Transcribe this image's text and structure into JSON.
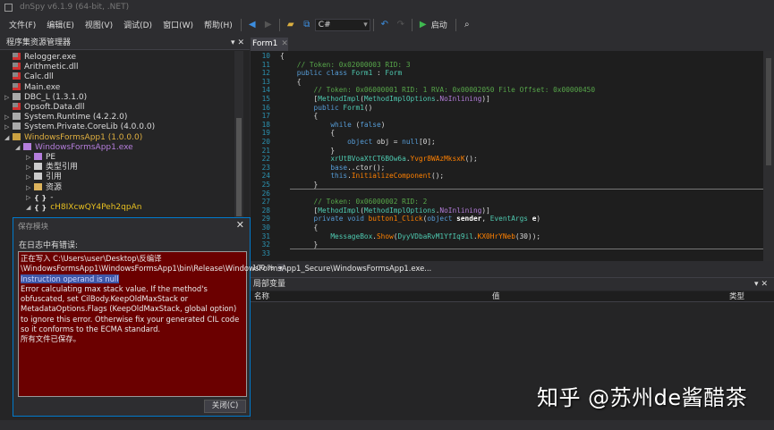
{
  "window": {
    "title": "dnSpy v6.1.9 (64-bit, .NET)"
  },
  "menu": [
    {
      "label": "文件(F)"
    },
    {
      "label": "编辑(E)"
    },
    {
      "label": "视图(V)"
    },
    {
      "label": "调试(D)"
    },
    {
      "label": "窗口(W)"
    },
    {
      "label": "帮助(H)"
    }
  ],
  "toolbar": {
    "language": "C#",
    "start_label": "启动"
  },
  "assembly_explorer": {
    "title": "程序集资源管理器",
    "nodes": [
      {
        "label": "Relogger.exe",
        "depth": 0,
        "expander": "",
        "icon": "assembly-error",
        "color": "#dcdcdc"
      },
      {
        "label": "Arithmetic.dll",
        "depth": 0,
        "expander": "",
        "icon": "assembly-error",
        "color": "#dcdcdc"
      },
      {
        "label": "Calc.dll",
        "depth": 0,
        "expander": "",
        "icon": "assembly-error",
        "color": "#dcdcdc"
      },
      {
        "label": "Main.exe",
        "depth": 0,
        "expander": "",
        "icon": "assembly-error",
        "color": "#dcdcdc"
      },
      {
        "label": "DBC_L (1.3.1.0)",
        "depth": 0,
        "expander": "▷",
        "icon": "assembly",
        "color": "#dcdcdc"
      },
      {
        "label": "Opsoft.Data.dll",
        "depth": 0,
        "expander": "",
        "icon": "assembly-error",
        "color": "#dcdcdc"
      },
      {
        "label": "System.Runtime (4.2.2.0)",
        "depth": 0,
        "expander": "▷",
        "icon": "assembly",
        "color": "#dcdcdc"
      },
      {
        "label": "System.Private.CoreLib (4.0.0.0)",
        "depth": 0,
        "expander": "▷",
        "icon": "assembly",
        "color": "#dcdcdc"
      },
      {
        "label": "WindowsFormsApp1 (1.0.0.0)",
        "depth": 0,
        "expander": "◢",
        "icon": "assembly-open",
        "color": "#e0b040"
      },
      {
        "label": "WindowsFormsApp1.exe",
        "depth": 1,
        "expander": "◢",
        "icon": "module",
        "color": "#b57edc"
      },
      {
        "label": "PE",
        "depth": 2,
        "expander": "▷",
        "icon": "module",
        "color": "#dcdcdc"
      },
      {
        "label": "类型引用",
        "depth": 2,
        "expander": "▷",
        "icon": "references",
        "color": "#dcdcdc"
      },
      {
        "label": "引用",
        "depth": 2,
        "expander": "▷",
        "icon": "references",
        "color": "#dcdcdc"
      },
      {
        "label": "资源",
        "depth": 2,
        "expander": "▷",
        "icon": "folder",
        "color": "#dcdcdc"
      },
      {
        "label": "-",
        "depth": 2,
        "expander": "▷",
        "icon": "namespace",
        "color": "#dcdcdc"
      },
      {
        "label": "cH8IXcwQY4Peh2qpAn",
        "depth": 2,
        "expander": "◢",
        "icon": "namespace",
        "color": "#e8c020"
      }
    ]
  },
  "editor": {
    "tab": "Form1",
    "zoom": "100 %",
    "lines": [
      {
        "n": "10",
        "tokens": [
          {
            "t": "{",
            "c": "pl"
          }
        ]
      },
      {
        "n": "11",
        "tokens": [
          {
            "t": "    // Token: 0x02000003 RID: 3",
            "c": "cm"
          }
        ]
      },
      {
        "n": "12",
        "tokens": [
          {
            "t": "    public class ",
            "c": "kw"
          },
          {
            "t": "Form1",
            "c": "ty"
          },
          {
            "t": " : ",
            "c": "pl"
          },
          {
            "t": "Form",
            "c": "ty"
          }
        ]
      },
      {
        "n": "13",
        "tokens": [
          {
            "t": "    {",
            "c": "pl"
          }
        ]
      },
      {
        "n": "14",
        "tokens": [
          {
            "t": "        // Token: 0x06000001 RID: 1 RVA: 0x00002050 File Offset: 0x00000450",
            "c": "cm"
          }
        ]
      },
      {
        "n": "15",
        "tokens": [
          {
            "t": "        [",
            "c": "pl"
          },
          {
            "t": "MethodImpl",
            "c": "ty"
          },
          {
            "t": "(",
            "c": "pl"
          },
          {
            "t": "MethodImplOptions",
            "c": "ty"
          },
          {
            "t": ".",
            "c": "pl"
          },
          {
            "t": "NoInlining",
            "c": "en"
          },
          {
            "t": ")]",
            "c": "pl"
          }
        ]
      },
      {
        "n": "16",
        "tokens": [
          {
            "t": "        public ",
            "c": "kw"
          },
          {
            "t": "Form1",
            "c": "ty"
          },
          {
            "t": "()",
            "c": "pl"
          }
        ]
      },
      {
        "n": "17",
        "tokens": [
          {
            "t": "        {",
            "c": "pl"
          }
        ]
      },
      {
        "n": "18",
        "tokens": [
          {
            "t": "            while ",
            "c": "kw"
          },
          {
            "t": "(",
            "c": "pl"
          },
          {
            "t": "false",
            "c": "kw"
          },
          {
            "t": ")",
            "c": "pl"
          }
        ]
      },
      {
        "n": "19",
        "tokens": [
          {
            "t": "            {",
            "c": "pl"
          }
        ]
      },
      {
        "n": "20",
        "tokens": [
          {
            "t": "                object ",
            "c": "kw"
          },
          {
            "t": "obj",
            "c": "pl"
          },
          {
            "t": " = ",
            "c": "pl"
          },
          {
            "t": "null",
            "c": "kw"
          },
          {
            "t": "[0];",
            "c": "pl"
          }
        ]
      },
      {
        "n": "21",
        "tokens": [
          {
            "t": "            }",
            "c": "pl"
          }
        ]
      },
      {
        "n": "22",
        "tokens": [
          {
            "t": "            xrUtBVoaXtCT6BOw6a",
            "c": "ty"
          },
          {
            "t": ".",
            "c": "pl"
          },
          {
            "t": "Yvgr8WAzMksxK",
            "c": "me"
          },
          {
            "t": "();",
            "c": "pl"
          }
        ]
      },
      {
        "n": "23",
        "tokens": [
          {
            "t": "            base",
            "c": "kw"
          },
          {
            "t": "..ctor();",
            "c": "pl"
          }
        ]
      },
      {
        "n": "24",
        "tokens": [
          {
            "t": "            this",
            "c": "kw"
          },
          {
            "t": ".",
            "c": "pl"
          },
          {
            "t": "InitializeComponent",
            "c": "me"
          },
          {
            "t": "();",
            "c": "pl"
          }
        ]
      },
      {
        "n": "25",
        "tokens": [
          {
            "t": "        }",
            "c": "pl"
          }
        ],
        "sep": true
      },
      {
        "n": "26",
        "tokens": []
      },
      {
        "n": "27",
        "tokens": [
          {
            "t": "        // Token: 0x06000002 RID: 2",
            "c": "cm"
          }
        ]
      },
      {
        "n": "28",
        "tokens": [
          {
            "t": "        [",
            "c": "pl"
          },
          {
            "t": "MethodImpl",
            "c": "ty"
          },
          {
            "t": "(",
            "c": "pl"
          },
          {
            "t": "MethodImplOptions",
            "c": "ty"
          },
          {
            "t": ".",
            "c": "pl"
          },
          {
            "t": "NoInlining",
            "c": "en"
          },
          {
            "t": ")]",
            "c": "pl"
          }
        ]
      },
      {
        "n": "29",
        "tokens": [
          {
            "t": "        private void ",
            "c": "kw"
          },
          {
            "t": "button1_Click",
            "c": "me"
          },
          {
            "t": "(",
            "c": "pl"
          },
          {
            "t": "object ",
            "c": "kw"
          },
          {
            "t": "sender",
            "c": "pa"
          },
          {
            "t": ", ",
            "c": "pl"
          },
          {
            "t": "EventArgs ",
            "c": "ty"
          },
          {
            "t": "e",
            "c": "pa"
          },
          {
            "t": ")",
            "c": "pl"
          }
        ]
      },
      {
        "n": "30",
        "tokens": [
          {
            "t": "        {",
            "c": "pl"
          }
        ]
      },
      {
        "n": "31",
        "tokens": [
          {
            "t": "            MessageBox",
            "c": "ty"
          },
          {
            "t": ".",
            "c": "pl"
          },
          {
            "t": "Show",
            "c": "me"
          },
          {
            "t": "(",
            "c": "pl"
          },
          {
            "t": "DyyVDbaRvM1YfIq9il",
            "c": "ty"
          },
          {
            "t": ".",
            "c": "pl"
          },
          {
            "t": "KX0HrYNeb",
            "c": "me"
          },
          {
            "t": "(30));",
            "c": "pl"
          }
        ]
      },
      {
        "n": "32",
        "tokens": [
          {
            "t": "        }",
            "c": "pl"
          }
        ],
        "sep": true
      },
      {
        "n": "33",
        "tokens": []
      }
    ]
  },
  "locals": {
    "title": "局部变量",
    "columns": {
      "name": "名称",
      "value": "值",
      "type": "类型"
    }
  },
  "dialog": {
    "title": "保存模块",
    "subtitle": "在日志中有错误:",
    "log": [
      {
        "text": "正在写入 C:\\Users\\user\\Desktop\\反编译\\WindowsFormsApp1\\WindowsFormsApp1\\bin\\Release\\WindowsFormsApp1_Secure\\WindowsFormsApp1.exe...",
        "hl": false
      },
      {
        "text": "Instruction operand is null",
        "hl": true
      },
      {
        "text": "Error calculating max stack value. If the method's obfuscated, set CilBody.KeepOldMaxStack or MetadataOptions.Flags (KeepOldMaxStack, global option) to ignore this error. Otherwise fix your generated CIL code so it conforms to the ECMA standard.",
        "hl": false
      },
      {
        "text": "所有文件已保存。",
        "hl": false
      }
    ],
    "close_label": "关闭(C)"
  },
  "watermark": "知乎 @苏州de酱醋茶"
}
